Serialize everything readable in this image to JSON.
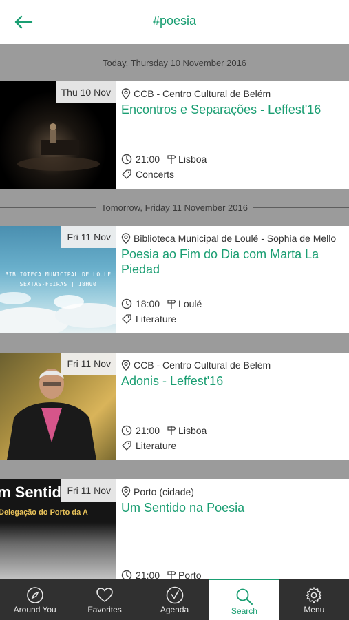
{
  "header": {
    "title": "#poesia"
  },
  "days": [
    {
      "label": "Today, Thursday 10 November 2016"
    },
    {
      "label": "Tomorrow, Friday 11 November 2016"
    }
  ],
  "events": [
    {
      "date": "Thu 10 Nov",
      "venue": "CCB - Centro Cultural de Belém",
      "title": "Encontros e Separações - Leffest'16",
      "time": "21:00",
      "city": "Lisboa",
      "category": "Concerts"
    },
    {
      "date": "Fri 11 Nov",
      "venue": "Biblioteca Municipal de Loulé - Sophia de Mello",
      "title": "Poesia ao Fim do Dia com Marta La Piedad",
      "time": "18:00",
      "city": "Loulé",
      "category": "Literature",
      "thumb_text_1": "BIBLIOTECA MUNICIPAL DE LOULÉ",
      "thumb_text_2": "SEXTAS-FEIRAS | 18H00"
    },
    {
      "date": "Fri 11 Nov",
      "venue": "CCB - Centro Cultural de Belém",
      "title": "Adonis - Leffest'16",
      "time": "21:00",
      "city": "Lisboa",
      "category": "Literature"
    },
    {
      "date": "Fri 11 Nov",
      "venue": "Porto (cidade)",
      "title": "Um Sentido na Poesia",
      "time": "21:00",
      "city": "Porto",
      "thumb_text_1": "m Sentid",
      "thumb_text_2": "Delegação do Porto da A"
    }
  ],
  "nav": {
    "items": [
      {
        "label": "Around You",
        "icon": "compass-icon"
      },
      {
        "label": "Favorites",
        "icon": "heart-icon"
      },
      {
        "label": "Agenda",
        "icon": "checkmark-icon"
      },
      {
        "label": "Search",
        "icon": "search-icon",
        "active": true
      },
      {
        "label": "Menu",
        "icon": "gear-icon"
      }
    ]
  },
  "colors": {
    "accent": "#1a9e72",
    "separator_bg": "#9b9b9b",
    "nav_bg": "#303030"
  }
}
